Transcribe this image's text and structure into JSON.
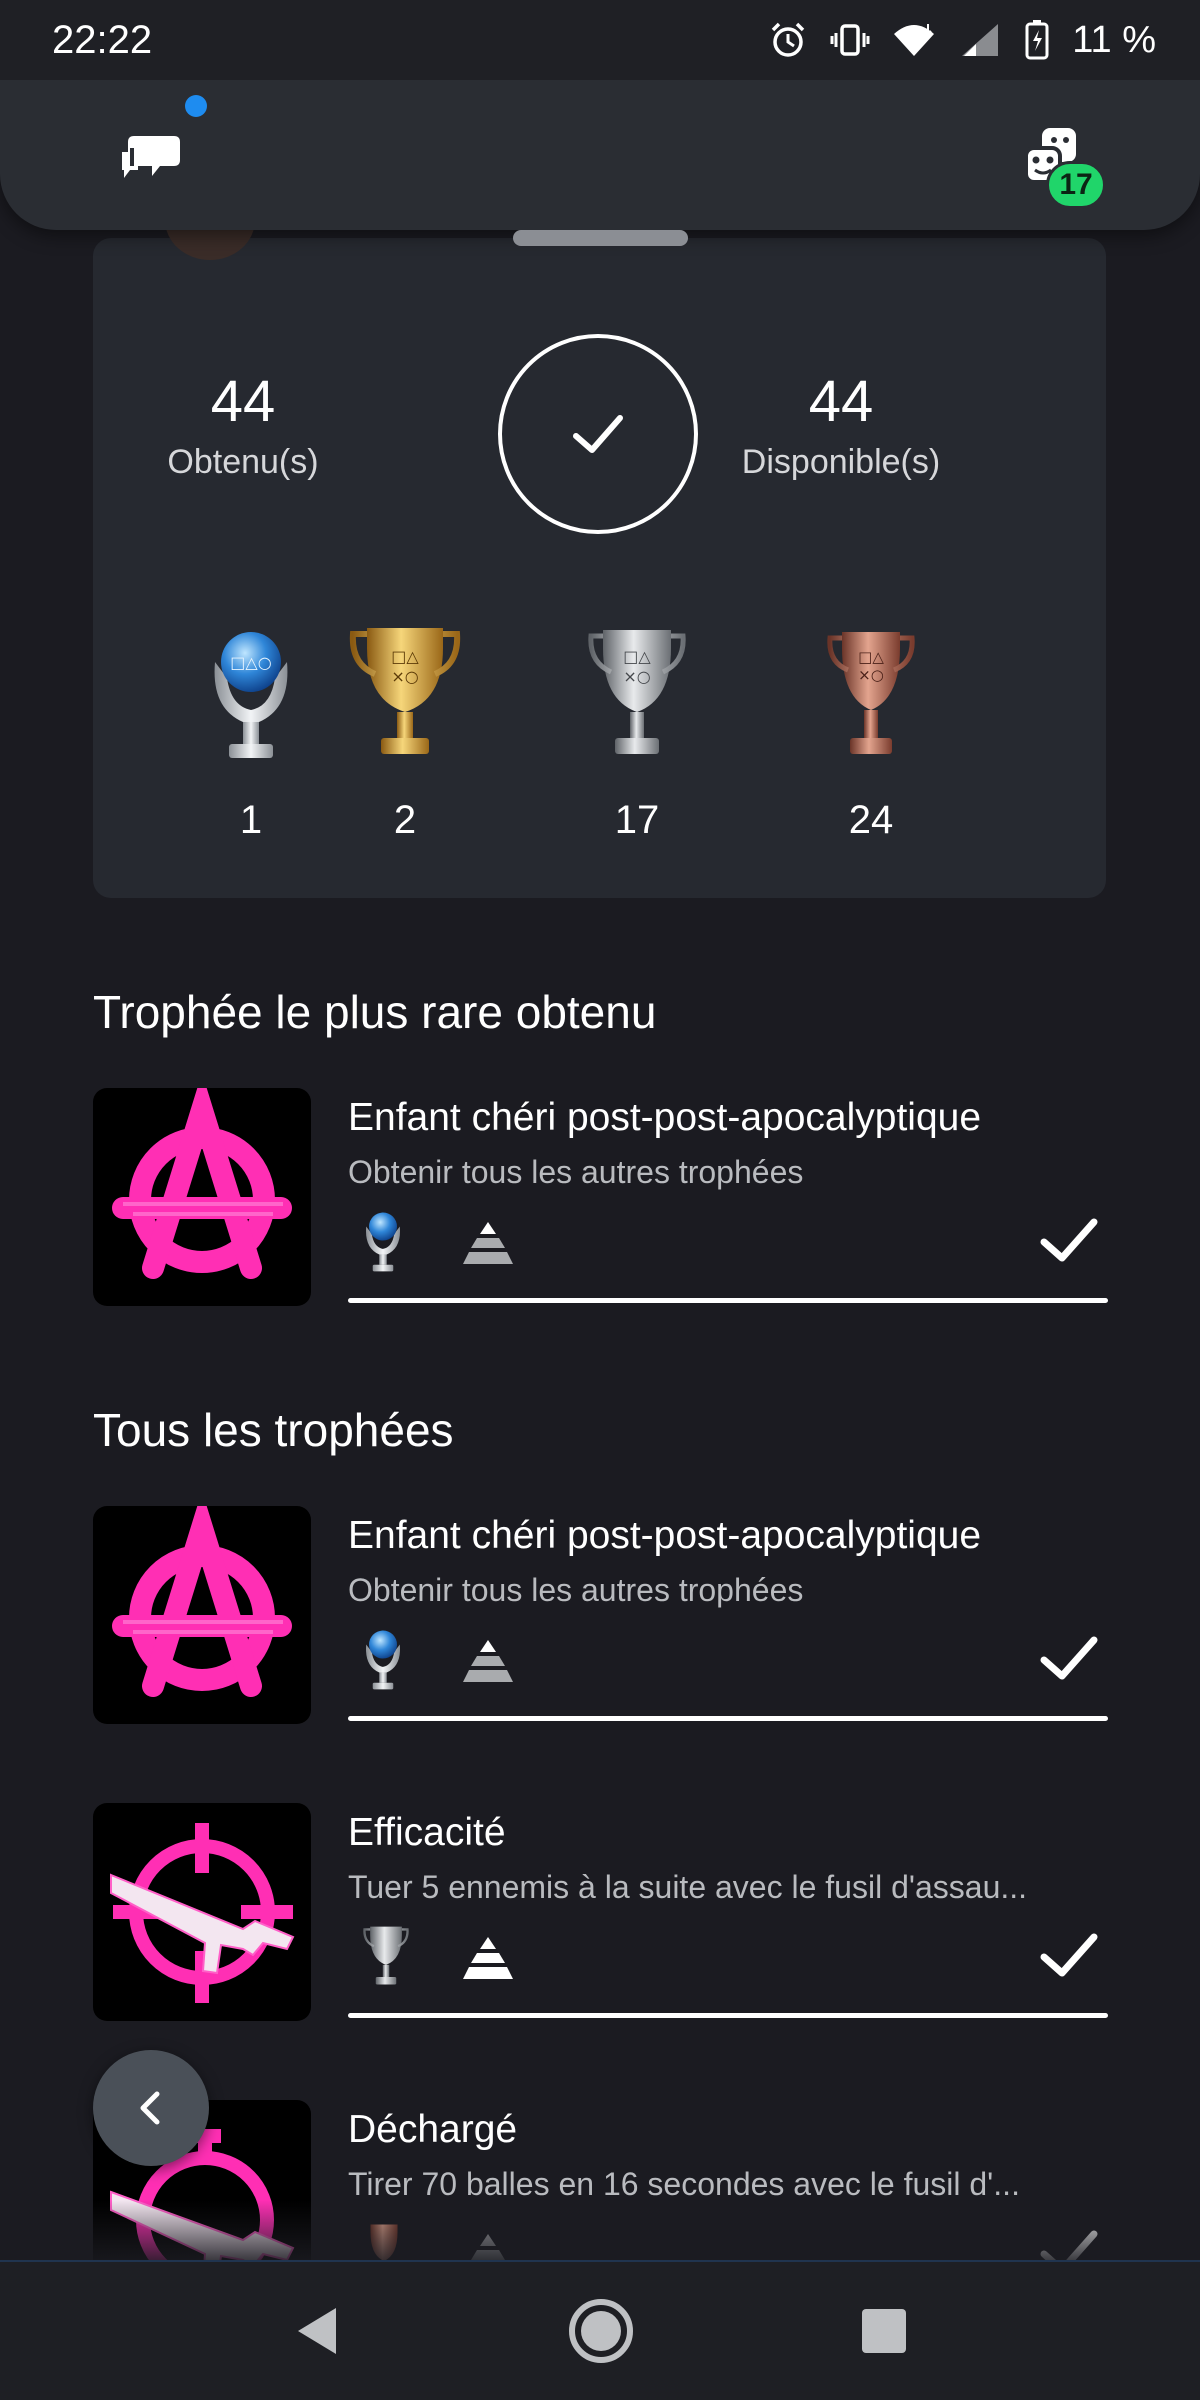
{
  "status_bar": {
    "time": "22:22",
    "battery": "11 %"
  },
  "top_panel": {
    "game_badge_count": "17"
  },
  "summary": {
    "earned_count": "44",
    "earned_label": "Obtenu(s)",
    "available_count": "44",
    "available_label": "Disponible(s)",
    "tiers": [
      {
        "name": "platinum",
        "count": "1"
      },
      {
        "name": "gold",
        "count": "2"
      },
      {
        "name": "silver",
        "count": "17"
      },
      {
        "name": "bronze",
        "count": "24"
      }
    ]
  },
  "rarest_section": {
    "title": "Trophée le plus rare obtenu",
    "trophy": {
      "name": "Enfant chéri post-post-apocalyptique",
      "description": "Obtenir tous les autres trophées",
      "tier": "platinum",
      "progress": 1.0
    }
  },
  "all_section": {
    "title": "Tous les trophées",
    "trophies": [
      {
        "name": "Enfant chéri post-post-apocalyptique",
        "description": "Obtenir tous les autres trophées",
        "tier": "platinum",
        "icon": "anarchy-icon",
        "progress": 1.0
      },
      {
        "name": "Efficacité",
        "description": "Tuer 5 ennemis à la suite avec le fusil d'assau...",
        "tier": "silver",
        "icon": "crosshair-rifle-icon",
        "progress": 1.0
      },
      {
        "name": "Déchargé",
        "description": "Tirer 70 balles en 16 secondes avec le fusil d'...",
        "tier": "bronze",
        "icon": "stopwatch-rifle-icon",
        "progress": 1.0
      }
    ]
  },
  "colors": {
    "background": "#1b1b21",
    "card": "#262930",
    "accent_green": "#20d56a",
    "accent_blue": "#1e8cf0",
    "magenta": "#ff2fb4"
  }
}
